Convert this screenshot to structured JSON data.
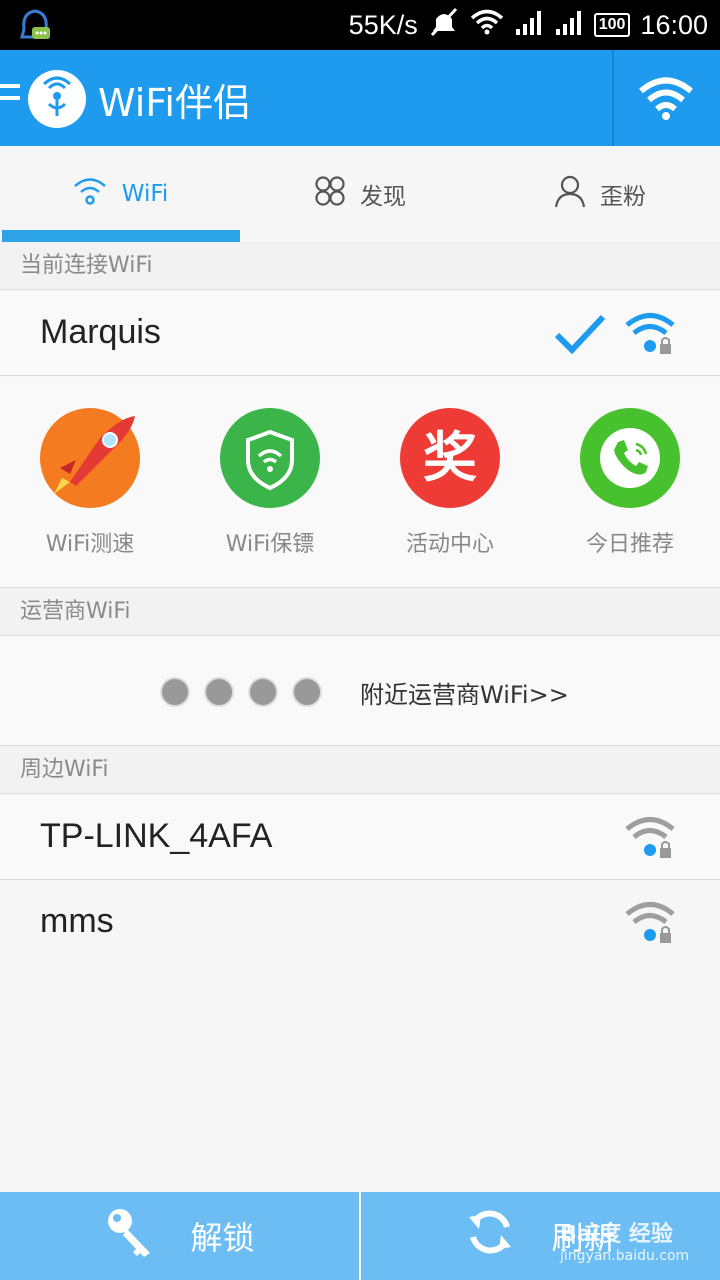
{
  "status_bar": {
    "speed": "55K/s",
    "battery": "100",
    "time": "16:00"
  },
  "title_bar": {
    "app_title": "WiFi伴侣"
  },
  "tabs": [
    {
      "label": "WiFi",
      "icon": "wifi-icon",
      "active": true
    },
    {
      "label": "发现",
      "icon": "grid-icon",
      "active": false
    },
    {
      "label": "歪粉",
      "icon": "person-icon",
      "active": false
    }
  ],
  "current_section": {
    "header": "当前连接WiFi",
    "network": "Marquis"
  },
  "features": [
    {
      "label": "WiFi测速",
      "color": "#f47b20"
    },
    {
      "label": "WiFi保镖",
      "color": "#3bb54a"
    },
    {
      "label": "活动中心",
      "color": "#ef3b36",
      "glyph": "奖"
    },
    {
      "label": "今日推荐",
      "color": "#48c12e"
    }
  ],
  "operator_section": {
    "header": "运营商WiFi",
    "link": "附近运营商WiFi>>"
  },
  "nearby_section": {
    "header": "周边WiFi",
    "networks": [
      "TP-LINK_4AFA",
      "mms"
    ]
  },
  "bottom_bar": {
    "unlock_label": "解锁",
    "refresh_label": "刷新"
  },
  "watermark": {
    "line1": "Bai度 经验",
    "line2": "jingyan.baidu.com"
  },
  "colors": {
    "primary": "#1e9bef",
    "bottom_bar": "#6bbdf4"
  }
}
